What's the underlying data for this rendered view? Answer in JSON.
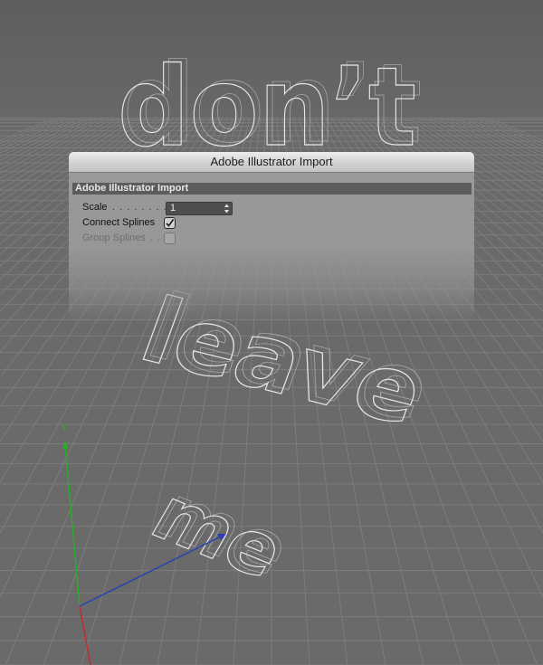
{
  "scene": {
    "words": [
      "don’t",
      "leave",
      "me"
    ],
    "colors": {
      "background": "#6a6a6a",
      "grid": "#7d7d7d",
      "outline": "#e6e6e6",
      "axis_x": "#c0302a",
      "axis_y": "#27b025",
      "axis_z": "#2d3fb8"
    },
    "axis_y_label": "Y"
  },
  "dialog": {
    "title": "Adobe Illustrator Import",
    "section_header": "Adobe Illustrator Import",
    "scale": {
      "label": "Scale",
      "dots": ". . . . . . . . .",
      "value": "1",
      "stepper_icon": "up-down-arrows-icon"
    },
    "connect_splines": {
      "label": "Connect Splines",
      "checked": true
    },
    "group_splines": {
      "label": "Group Splines",
      "dots": ". .",
      "checked": false,
      "disabled": true
    }
  }
}
